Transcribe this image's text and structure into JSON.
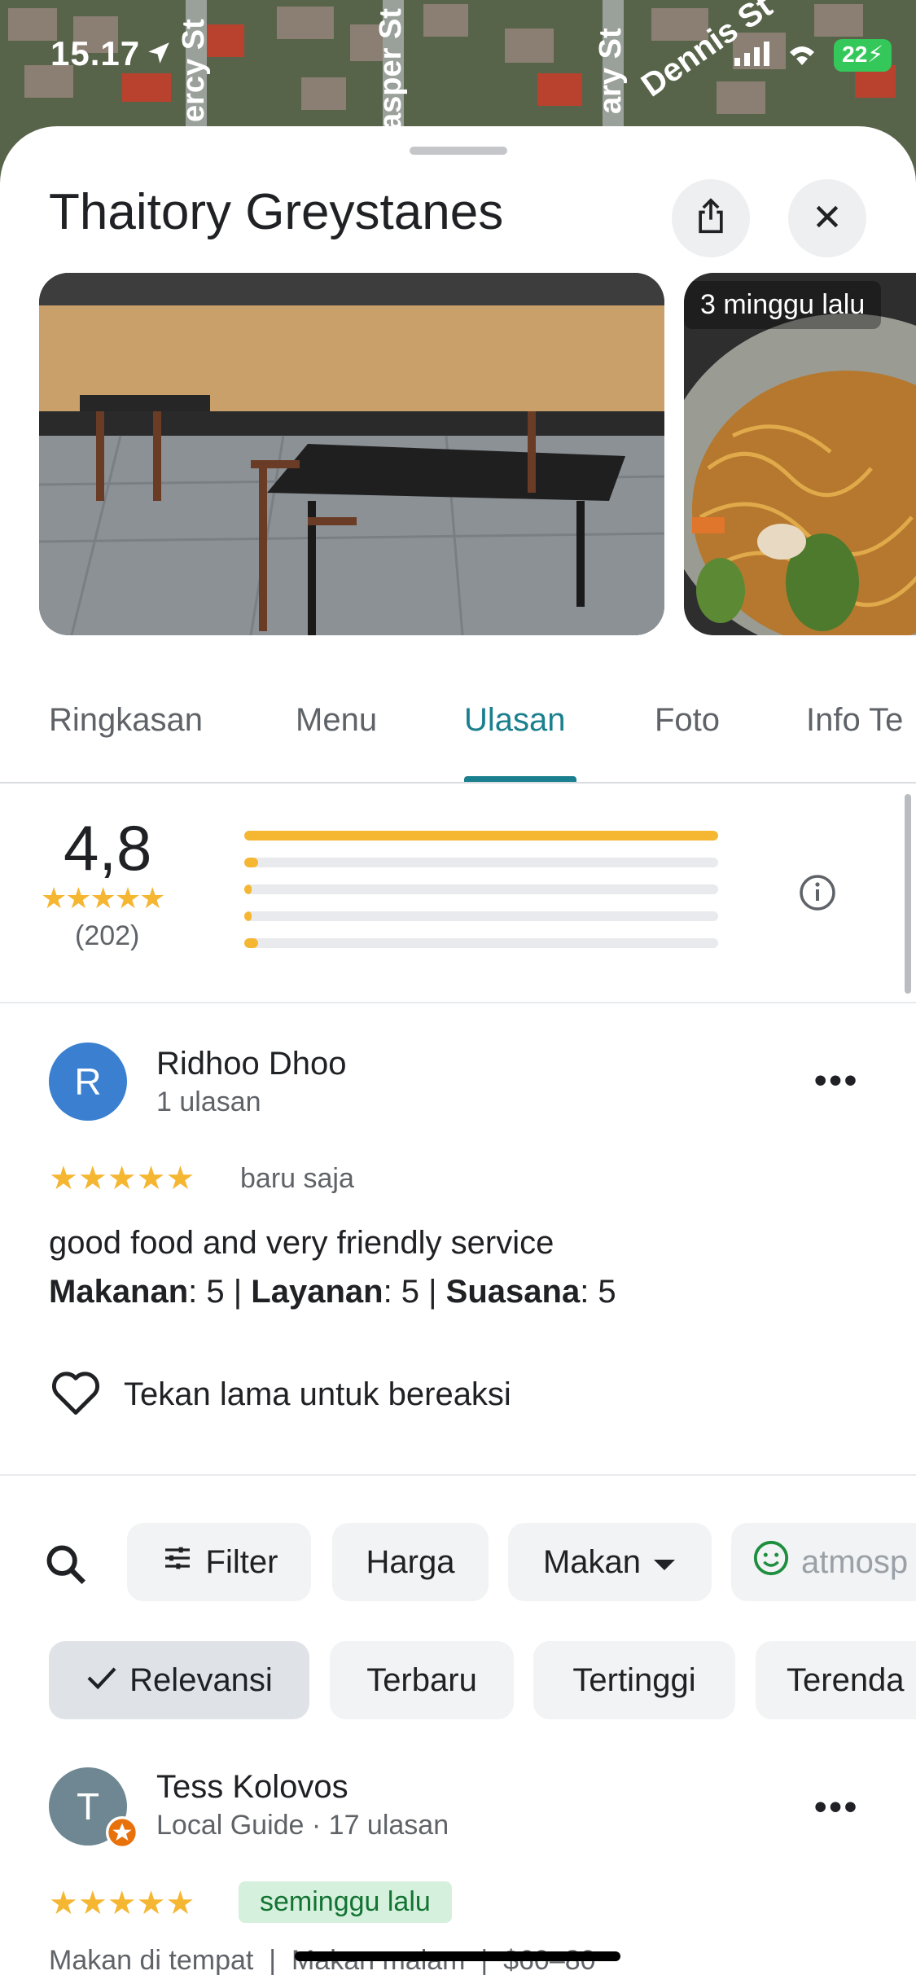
{
  "status_bar": {
    "time": "15.17",
    "battery": "22"
  },
  "map": {
    "street_labels": [
      "ercy St",
      "asper St",
      "ary St",
      "Dennis St"
    ]
  },
  "header": {
    "title": "Thaitory Greystanes"
  },
  "photos": {
    "badge": "3 minggu lalu"
  },
  "tabs": [
    {
      "label": "Ringkasan",
      "active": false
    },
    {
      "label": "Menu",
      "active": false
    },
    {
      "label": "Ulasan",
      "active": true
    },
    {
      "label": "Foto",
      "active": false
    },
    {
      "label": "Info Te",
      "active": false
    }
  ],
  "rating": {
    "score": "4,8",
    "stars": "★★★★★",
    "count": "(202)",
    "distribution": [
      {
        "stars": 5,
        "fraction": 1.0
      },
      {
        "stars": 4,
        "fraction": 0.03
      },
      {
        "stars": 3,
        "fraction": 0.01
      },
      {
        "stars": 2,
        "fraction": 0.015
      },
      {
        "stars": 1,
        "fraction": 0.03
      }
    ]
  },
  "review1": {
    "avatar_letter": "R",
    "name": "Ridhoo Dhoo",
    "sub": "1 ulasan",
    "stars": "★★★★★",
    "time": "baru saja",
    "text": "good food and very friendly service",
    "scores": {
      "food_label": "Makanan",
      "food_value": ": 5 | ",
      "service_label": "Layanan",
      "service_value": ": 5 | ",
      "ambience_label": "Suasana",
      "ambience_value": ": 5"
    },
    "react_label": "Tekan lama untuk bereaksi"
  },
  "filters": [
    {
      "label": "Filter",
      "icon": "sliders-icon"
    },
    {
      "label": "Harga"
    },
    {
      "label": "Makan",
      "icon": "caret-down-icon"
    },
    {
      "label": "atmosp",
      "icon": "smiley-icon"
    }
  ],
  "sort": [
    {
      "label": "Relevansi",
      "selected": true
    },
    {
      "label": "Terbaru",
      "selected": false
    },
    {
      "label": "Tertinggi",
      "selected": false
    },
    {
      "label": "Terenda",
      "selected": false
    }
  ],
  "review2": {
    "avatar_letter": "T",
    "name": "Tess Kolovos",
    "sub": "Local Guide · 17 ulasan",
    "stars": "★★★★★",
    "time": "seminggu lalu",
    "meta": "Makan di tempat  |  Makan malam  |  $60–80"
  },
  "colors": {
    "accent": "#1a7f8e",
    "star": "#f5b632",
    "avatar1": "#3b7fd0",
    "avatar2": "#6f8793",
    "badge_green": "#d5f0dc"
  }
}
